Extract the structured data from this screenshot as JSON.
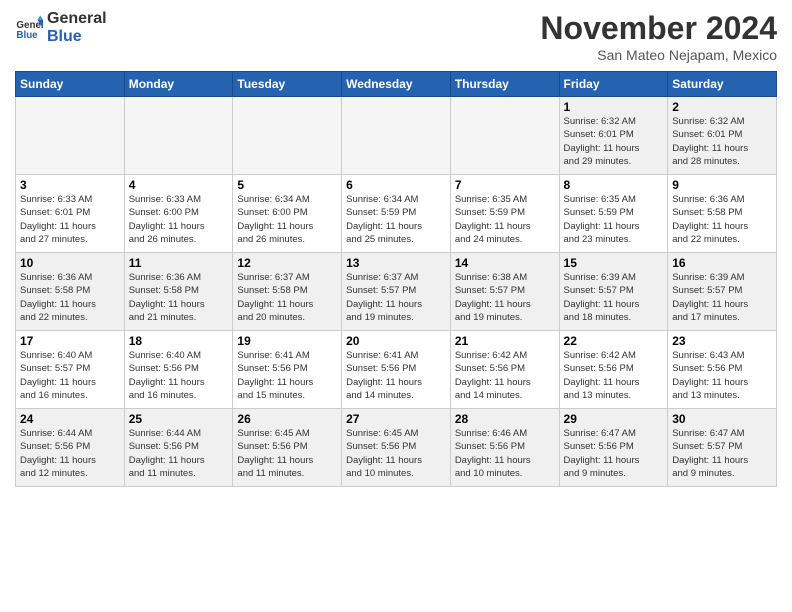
{
  "logo": {
    "line1": "General",
    "line2": "Blue"
  },
  "title": "November 2024",
  "location": "San Mateo Nejapam, Mexico",
  "headers": [
    "Sunday",
    "Monday",
    "Tuesday",
    "Wednesday",
    "Thursday",
    "Friday",
    "Saturday"
  ],
  "weeks": [
    [
      {
        "day": "",
        "info": ""
      },
      {
        "day": "",
        "info": ""
      },
      {
        "day": "",
        "info": ""
      },
      {
        "day": "",
        "info": ""
      },
      {
        "day": "",
        "info": ""
      },
      {
        "day": "1",
        "info": "Sunrise: 6:32 AM\nSunset: 6:01 PM\nDaylight: 11 hours\nand 29 minutes."
      },
      {
        "day": "2",
        "info": "Sunrise: 6:32 AM\nSunset: 6:01 PM\nDaylight: 11 hours\nand 28 minutes."
      }
    ],
    [
      {
        "day": "3",
        "info": "Sunrise: 6:33 AM\nSunset: 6:01 PM\nDaylight: 11 hours\nand 27 minutes."
      },
      {
        "day": "4",
        "info": "Sunrise: 6:33 AM\nSunset: 6:00 PM\nDaylight: 11 hours\nand 26 minutes."
      },
      {
        "day": "5",
        "info": "Sunrise: 6:34 AM\nSunset: 6:00 PM\nDaylight: 11 hours\nand 26 minutes."
      },
      {
        "day": "6",
        "info": "Sunrise: 6:34 AM\nSunset: 5:59 PM\nDaylight: 11 hours\nand 25 minutes."
      },
      {
        "day": "7",
        "info": "Sunrise: 6:35 AM\nSunset: 5:59 PM\nDaylight: 11 hours\nand 24 minutes."
      },
      {
        "day": "8",
        "info": "Sunrise: 6:35 AM\nSunset: 5:59 PM\nDaylight: 11 hours\nand 23 minutes."
      },
      {
        "day": "9",
        "info": "Sunrise: 6:36 AM\nSunset: 5:58 PM\nDaylight: 11 hours\nand 22 minutes."
      }
    ],
    [
      {
        "day": "10",
        "info": "Sunrise: 6:36 AM\nSunset: 5:58 PM\nDaylight: 11 hours\nand 22 minutes."
      },
      {
        "day": "11",
        "info": "Sunrise: 6:36 AM\nSunset: 5:58 PM\nDaylight: 11 hours\nand 21 minutes."
      },
      {
        "day": "12",
        "info": "Sunrise: 6:37 AM\nSunset: 5:58 PM\nDaylight: 11 hours\nand 20 minutes."
      },
      {
        "day": "13",
        "info": "Sunrise: 6:37 AM\nSunset: 5:57 PM\nDaylight: 11 hours\nand 19 minutes."
      },
      {
        "day": "14",
        "info": "Sunrise: 6:38 AM\nSunset: 5:57 PM\nDaylight: 11 hours\nand 19 minutes."
      },
      {
        "day": "15",
        "info": "Sunrise: 6:39 AM\nSunset: 5:57 PM\nDaylight: 11 hours\nand 18 minutes."
      },
      {
        "day": "16",
        "info": "Sunrise: 6:39 AM\nSunset: 5:57 PM\nDaylight: 11 hours\nand 17 minutes."
      }
    ],
    [
      {
        "day": "17",
        "info": "Sunrise: 6:40 AM\nSunset: 5:57 PM\nDaylight: 11 hours\nand 16 minutes."
      },
      {
        "day": "18",
        "info": "Sunrise: 6:40 AM\nSunset: 5:56 PM\nDaylight: 11 hours\nand 16 minutes."
      },
      {
        "day": "19",
        "info": "Sunrise: 6:41 AM\nSunset: 5:56 PM\nDaylight: 11 hours\nand 15 minutes."
      },
      {
        "day": "20",
        "info": "Sunrise: 6:41 AM\nSunset: 5:56 PM\nDaylight: 11 hours\nand 14 minutes."
      },
      {
        "day": "21",
        "info": "Sunrise: 6:42 AM\nSunset: 5:56 PM\nDaylight: 11 hours\nand 14 minutes."
      },
      {
        "day": "22",
        "info": "Sunrise: 6:42 AM\nSunset: 5:56 PM\nDaylight: 11 hours\nand 13 minutes."
      },
      {
        "day": "23",
        "info": "Sunrise: 6:43 AM\nSunset: 5:56 PM\nDaylight: 11 hours\nand 13 minutes."
      }
    ],
    [
      {
        "day": "24",
        "info": "Sunrise: 6:44 AM\nSunset: 5:56 PM\nDaylight: 11 hours\nand 12 minutes."
      },
      {
        "day": "25",
        "info": "Sunrise: 6:44 AM\nSunset: 5:56 PM\nDaylight: 11 hours\nand 11 minutes."
      },
      {
        "day": "26",
        "info": "Sunrise: 6:45 AM\nSunset: 5:56 PM\nDaylight: 11 hours\nand 11 minutes."
      },
      {
        "day": "27",
        "info": "Sunrise: 6:45 AM\nSunset: 5:56 PM\nDaylight: 11 hours\nand 10 minutes."
      },
      {
        "day": "28",
        "info": "Sunrise: 6:46 AM\nSunset: 5:56 PM\nDaylight: 11 hours\nand 10 minutes."
      },
      {
        "day": "29",
        "info": "Sunrise: 6:47 AM\nSunset: 5:56 PM\nDaylight: 11 hours\nand 9 minutes."
      },
      {
        "day": "30",
        "info": "Sunrise: 6:47 AM\nSunset: 5:57 PM\nDaylight: 11 hours\nand 9 minutes."
      }
    ]
  ]
}
